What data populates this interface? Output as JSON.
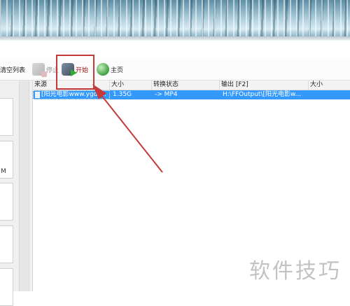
{
  "toolbar": {
    "clear_label": "清空列表",
    "stop_label": "停止",
    "start_label": "开始",
    "home_label": "主页"
  },
  "sidebar": {
    "partial_labels": [
      "M"
    ]
  },
  "list": {
    "columns": [
      "来源",
      "大小",
      "转换状态",
      "输出 [F2]",
      "大小"
    ],
    "rows": [
      {
        "source": "[阳光电影www.ygdy...",
        "size": "1.35G",
        "status": "-> MP4",
        "output": "H:\\FFOutput\\[阳光电影w...",
        "out_size": ""
      }
    ]
  },
  "watermark": "软件技巧",
  "colors": {
    "selection": "#3399ff",
    "highlight_box": "#c53a3a",
    "start_text": "#a01818"
  }
}
